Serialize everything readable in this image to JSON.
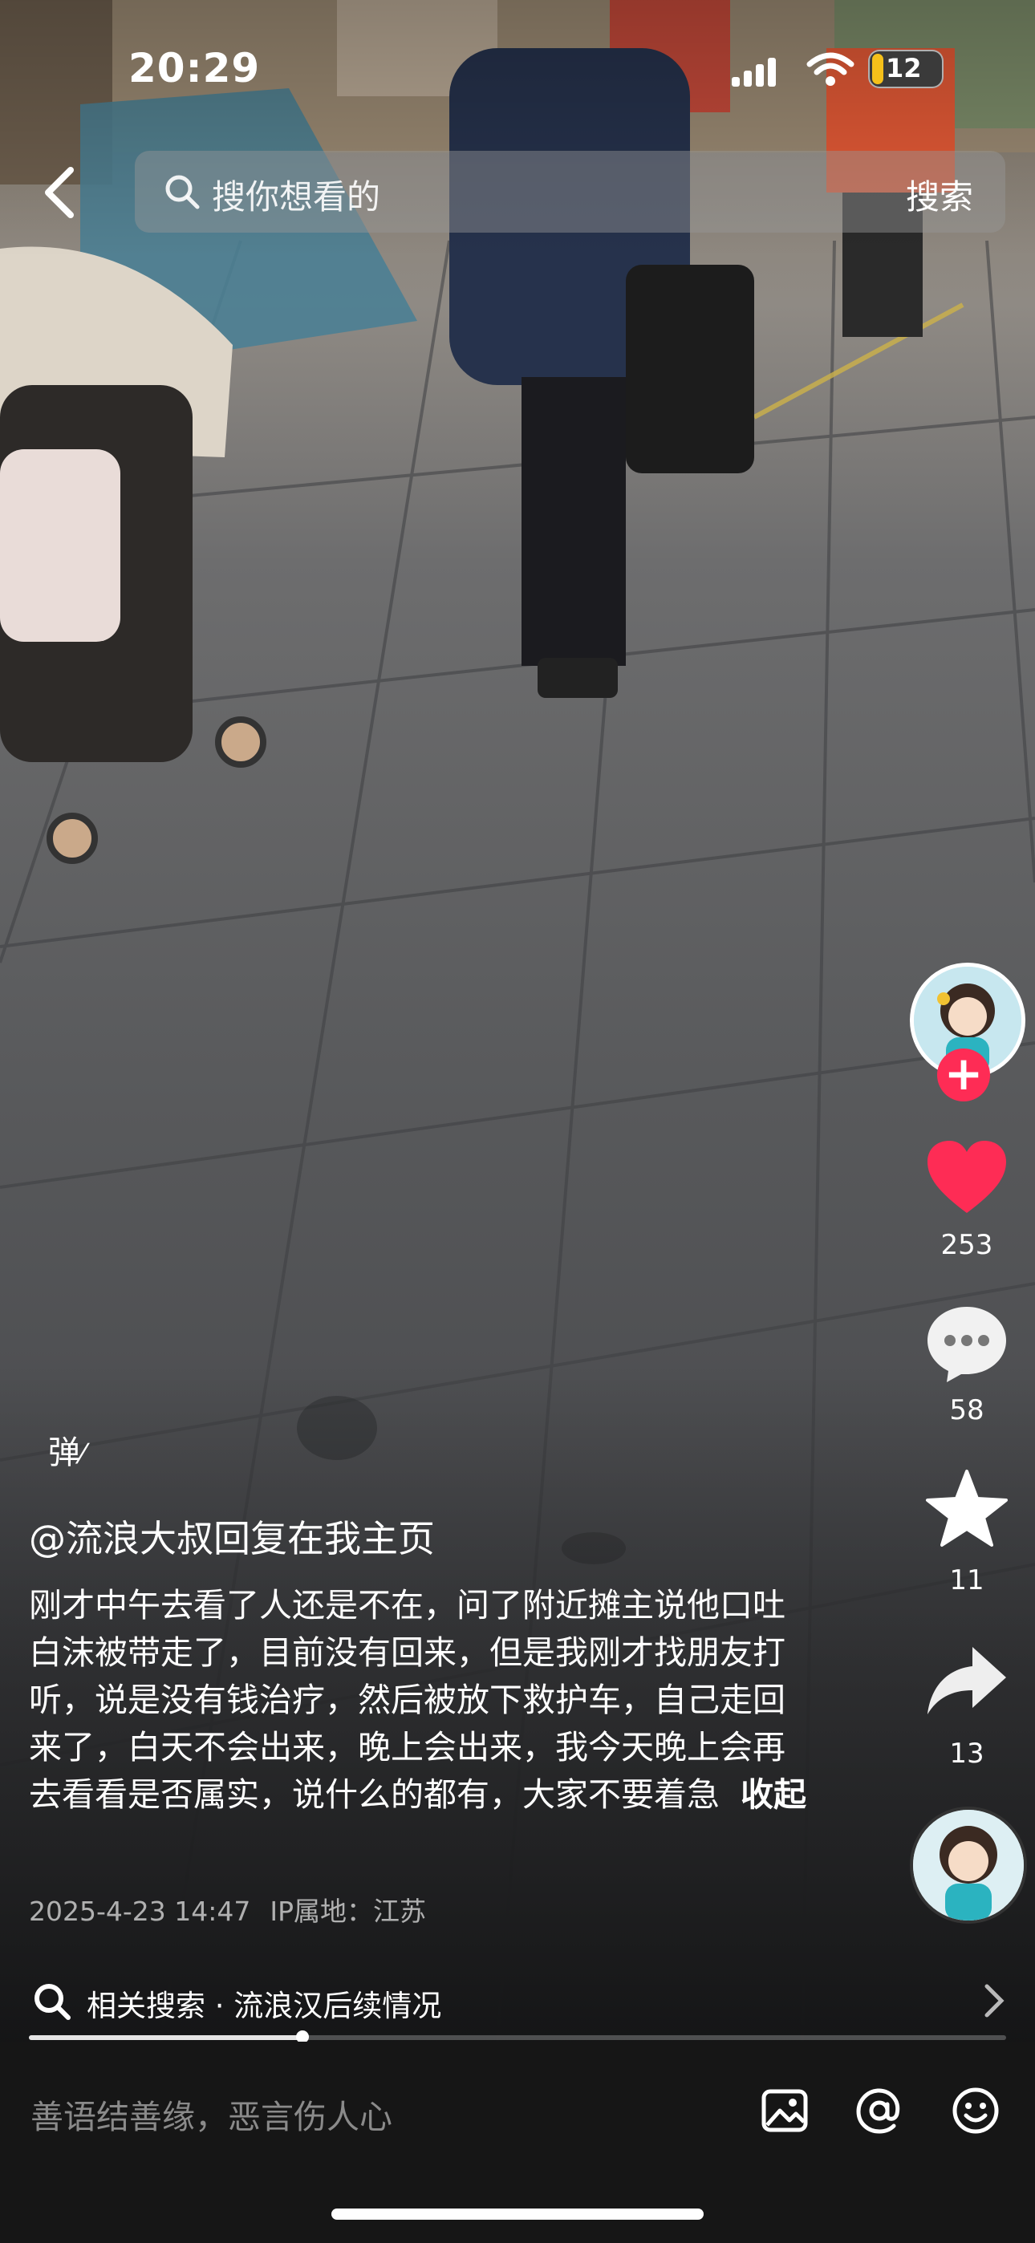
{
  "status_bar": {
    "time": "20:29",
    "battery": "12"
  },
  "search": {
    "placeholder": "搜你想看的",
    "button": "搜索"
  },
  "creator": {
    "handle": "@流浪大叔回复在我主页"
  },
  "caption": {
    "text": "刚才中午去看了人还是不在，问了附近摊主说他口吐白沫被带走了，目前没有回来，但是我刚才找朋友打听，说是没有钱治疗，然后被放下救护车，自己走回来了，白天不会出来，晚上会出来，我今天晚上会再去看看是否属实，说什么的都有，大家不要着急",
    "fold": "收起",
    "date": "2025-4-23 14:47",
    "ip": "IP属地：江苏"
  },
  "danmaku": "弹",
  "actions": {
    "likes": "253",
    "comments": "58",
    "favorites": "11",
    "shares": "13"
  },
  "related_search": {
    "label": "相关搜索",
    "separator": "·",
    "query": "流浪汉后续情况"
  },
  "playback": {
    "progress_fraction": 0.28
  },
  "comment_bar": {
    "placeholder": "善语结善缘，恶言伤人心"
  },
  "icons": {
    "back": "back-arrow-icon",
    "search": "search-icon",
    "like": "heart-icon",
    "comment": "comment-bubble-icon",
    "favorite": "star-icon",
    "share": "share-arrow-icon",
    "image": "image-icon",
    "mention": "at-icon",
    "emoji": "emoji-icon"
  },
  "colors": {
    "like": "#fe2c55",
    "follow": "#fe2c55",
    "battery": "#f5c01a",
    "bottom_bar": "#161616"
  }
}
